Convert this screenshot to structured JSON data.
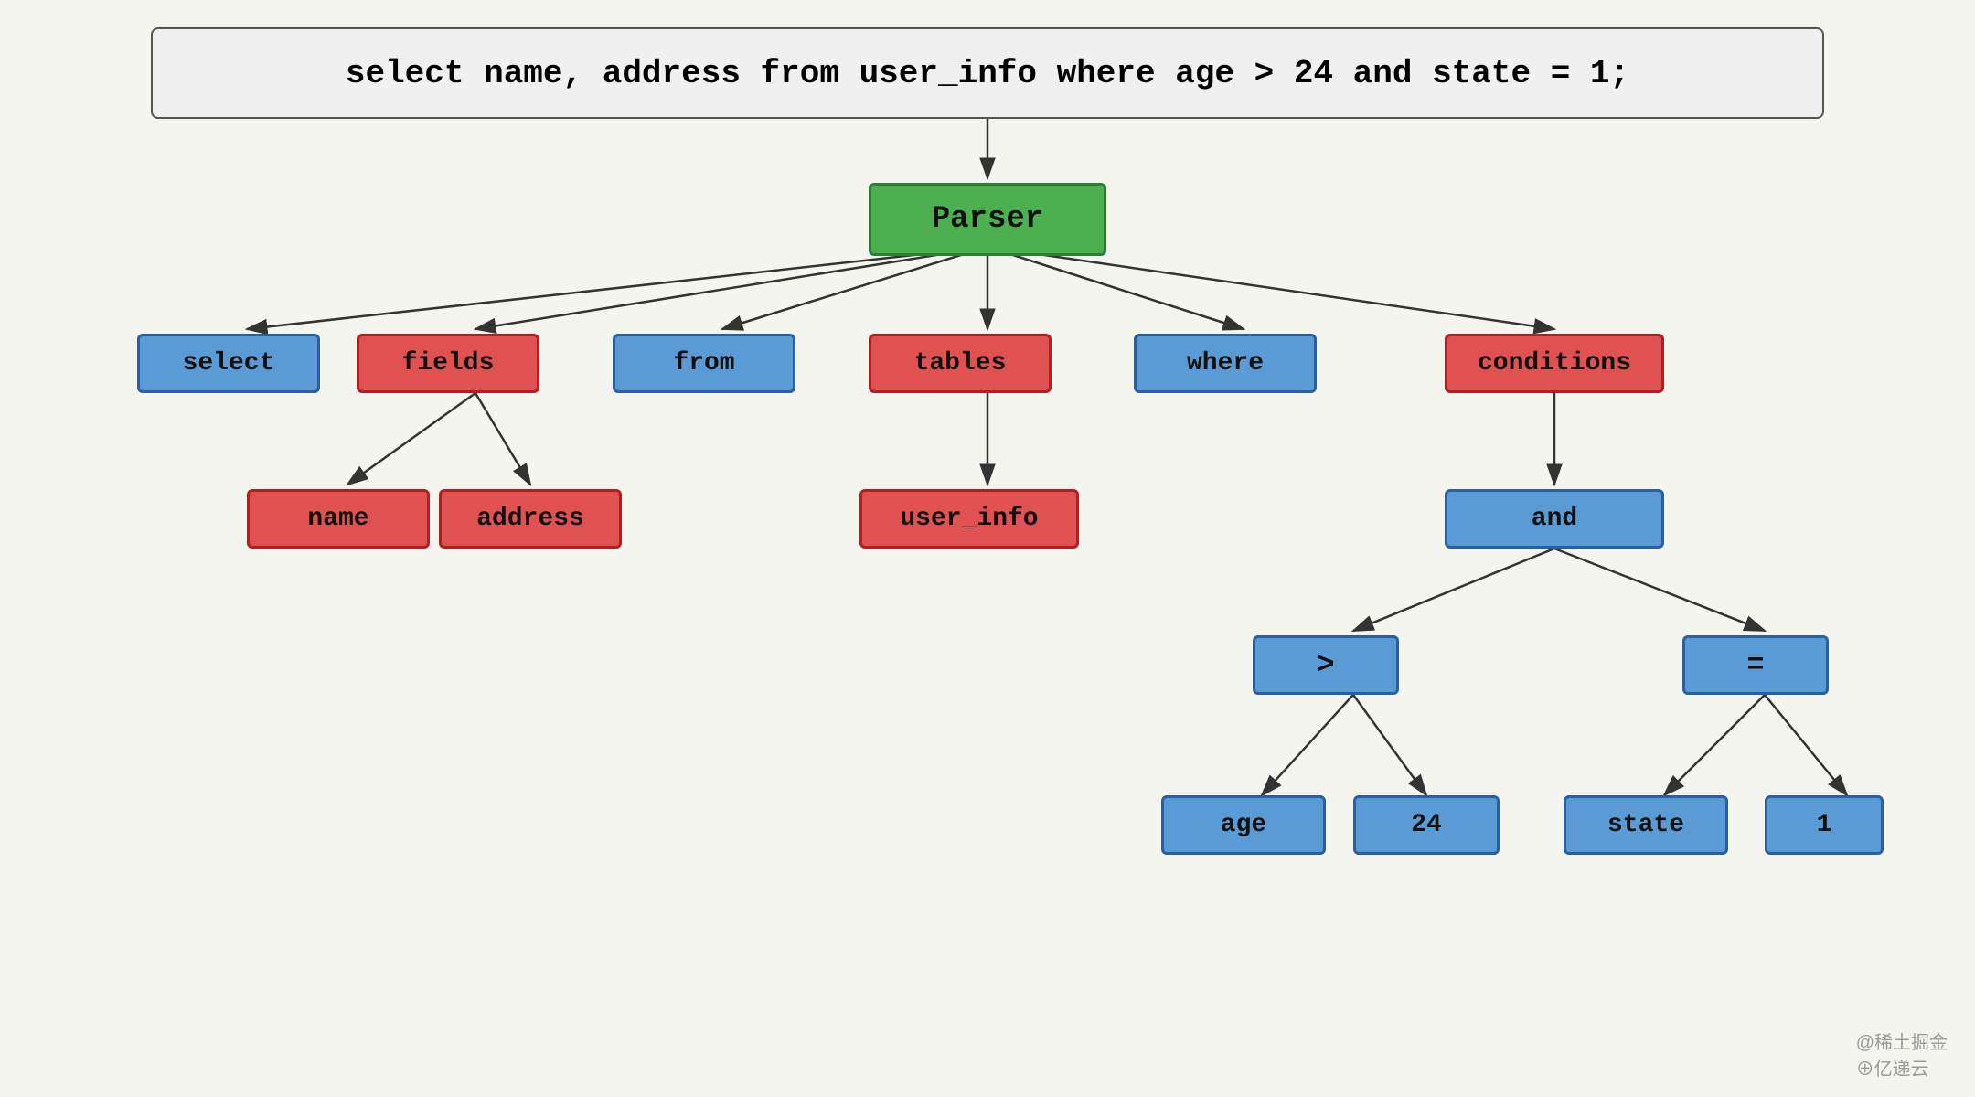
{
  "diagram": {
    "sql_label": "select name, address from user_info where age > 24 and state = 1;",
    "nodes": {
      "parser": "Parser",
      "select": "select",
      "fields": "fields",
      "from": "from",
      "tables": "tables",
      "where": "where",
      "conditions": "conditions",
      "name": "name",
      "address": "address",
      "user_info": "user_info",
      "and": "and",
      "gt": ">",
      "eq": "=",
      "age": "age",
      "twenty_four": "24",
      "state": "state",
      "one": "1"
    }
  },
  "watermark": {
    "line1": "@稀土掘金",
    "line2": "⊕亿递云"
  }
}
